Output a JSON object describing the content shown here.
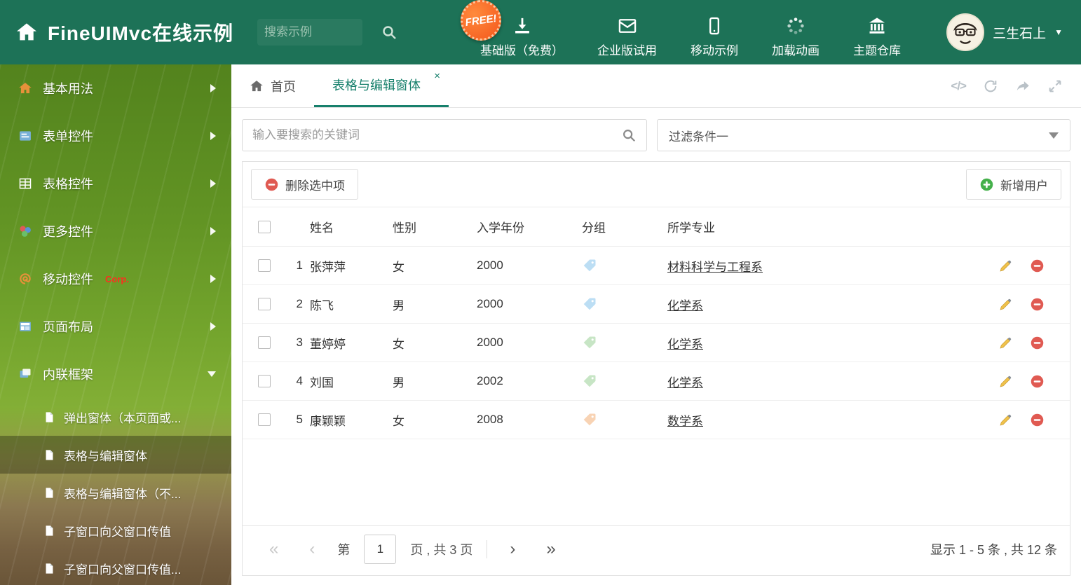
{
  "header": {
    "title": "FineUIMvc在线示例",
    "search_placeholder": "搜索示例",
    "free_badge": "FREE!",
    "nav_items": [
      {
        "label": "基础版（免费）",
        "icon": "download-icon"
      },
      {
        "label": "企业版试用",
        "icon": "envelope-icon"
      },
      {
        "label": "移动示例",
        "icon": "mobile-icon"
      },
      {
        "label": "加载动画",
        "icon": "spinner-icon"
      },
      {
        "label": "主题仓库",
        "icon": "bank-icon"
      }
    ],
    "user_name": "三生石上",
    "user_caret": "▼"
  },
  "sidebar": {
    "items": [
      {
        "label": "基本用法"
      },
      {
        "label": "表单控件"
      },
      {
        "label": "表格控件"
      },
      {
        "label": "更多控件"
      },
      {
        "label": "移动控件",
        "badge": "Corp."
      },
      {
        "label": "页面布局"
      },
      {
        "label": "内联框架"
      }
    ],
    "subitems": [
      {
        "label": "弹出窗体（本页面或..."
      },
      {
        "label": "表格与编辑窗体"
      },
      {
        "label": "表格与编辑窗体（不..."
      },
      {
        "label": "子窗口向父窗口传值"
      },
      {
        "label": "子窗口向父窗口传值..."
      }
    ]
  },
  "tabs": {
    "home_label": "首页",
    "active_label": "表格与编辑窗体",
    "close_glyph": "×"
  },
  "filters": {
    "search_placeholder": "输入要搜索的关键词",
    "filter_value": "过滤条件一"
  },
  "toolbar": {
    "delete_label": "删除选中项",
    "add_label": "新增用户"
  },
  "table": {
    "headers": {
      "name": "姓名",
      "gender": "性别",
      "year": "入学年份",
      "group": "分组",
      "major": "所学专业"
    },
    "rows": [
      {
        "num": "1",
        "name": "张萍萍",
        "gender": "女",
        "year": "2000",
        "tag_color": "#6db7e8",
        "major": "材料科学与工程系"
      },
      {
        "num": "2",
        "name": "陈飞",
        "gender": "男",
        "year": "2000",
        "tag_color": "#6db7e8",
        "major": "化学系"
      },
      {
        "num": "3",
        "name": "董婷婷",
        "gender": "女",
        "year": "2000",
        "tag_color": "#84c77f",
        "major": "化学系"
      },
      {
        "num": "4",
        "name": "刘国",
        "gender": "男",
        "year": "2002",
        "tag_color": "#84c77f",
        "major": "化学系"
      },
      {
        "num": "5",
        "name": "康颖颖",
        "gender": "女",
        "year": "2008",
        "tag_color": "#f0a05a",
        "major": "数学系"
      }
    ]
  },
  "pagination": {
    "first_glyph": "«",
    "prev_glyph": "‹",
    "page_prefix": "第",
    "current_page": "1",
    "page_suffix": "页 , 共 3 页",
    "next_glyph": "›",
    "last_glyph": "»",
    "summary": "显示 1 - 5 条 , 共 12 条"
  },
  "colors": {
    "header_bg": "#1d7257",
    "accent_teal": "#17806c",
    "danger_red": "#e05a52",
    "success_green": "#44b04a"
  }
}
